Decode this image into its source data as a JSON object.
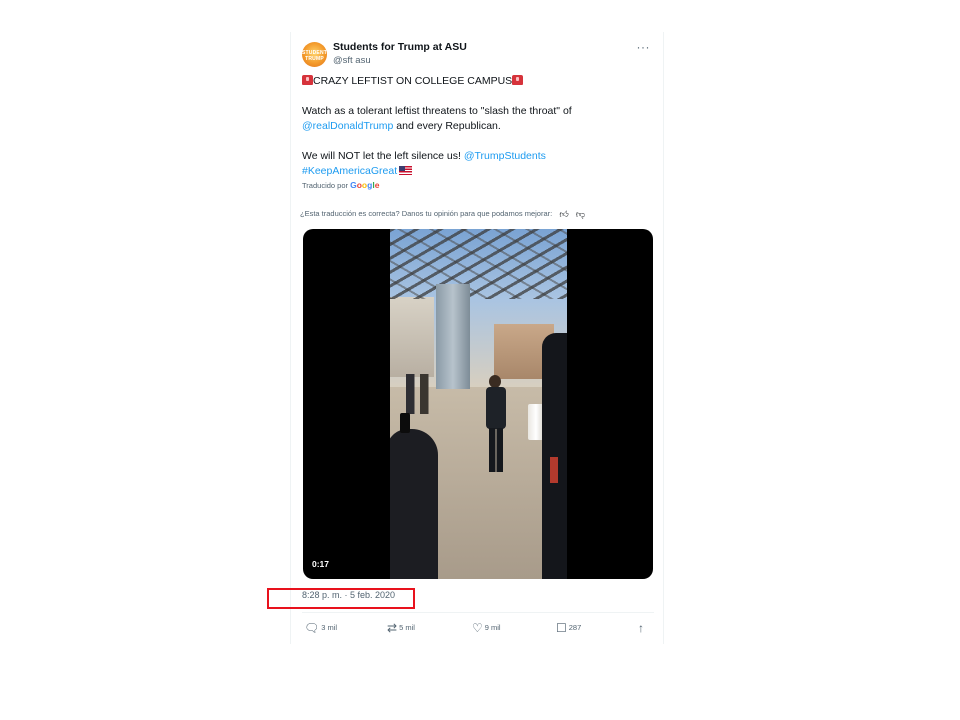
{
  "tweet": {
    "display_name": "Students for Trump at ASU",
    "handle": "@sft asu",
    "avatar_text": "STUDENTS TRUMP",
    "more_label": "···",
    "body": {
      "line1": "CRAZY LEFTIST ON COLLEGE CAMPUS",
      "line2": "Watch as a tolerant leftist threatens to \"slash the throat\" of",
      "line3_link": "@realDonaldTrump",
      "line3_text": " and every Republican.",
      "line4_text": "We will NOT let the left silence us! ",
      "line4_link": "@TrumpStudents",
      "line5_link": "#KeepAmericaGreat"
    },
    "translated_by": "Traducido por",
    "google": [
      "G",
      "o",
      "o",
      "g",
      "l",
      "e"
    ],
    "feedback_prompt": "¿Esta traducción es correcta? Danos tu opinión para que podamos mejorar:",
    "video": {
      "duration": "0:17"
    },
    "timestamp": "8:28 p. m. · 5 feb. 2020",
    "actions": {
      "replies": "3 mil",
      "retweets": "5 mil",
      "likes": "9 mil",
      "bookmarks": "287"
    }
  },
  "icons": {
    "reply": "reply-icon",
    "retweet": "retweet-icon",
    "like": "heart-icon",
    "bookmark": "bookmark-icon",
    "share": "share-icon",
    "thumbs_up": "thumbs-up-icon",
    "thumbs_down": "thumbs-down-icon",
    "siren": "siren-emoji-icon",
    "flag": "us-flag-emoji-icon"
  },
  "colors": {
    "link": "#1d9bf0",
    "secondary_text": "#536471",
    "highlight_box": "#e8121d"
  }
}
